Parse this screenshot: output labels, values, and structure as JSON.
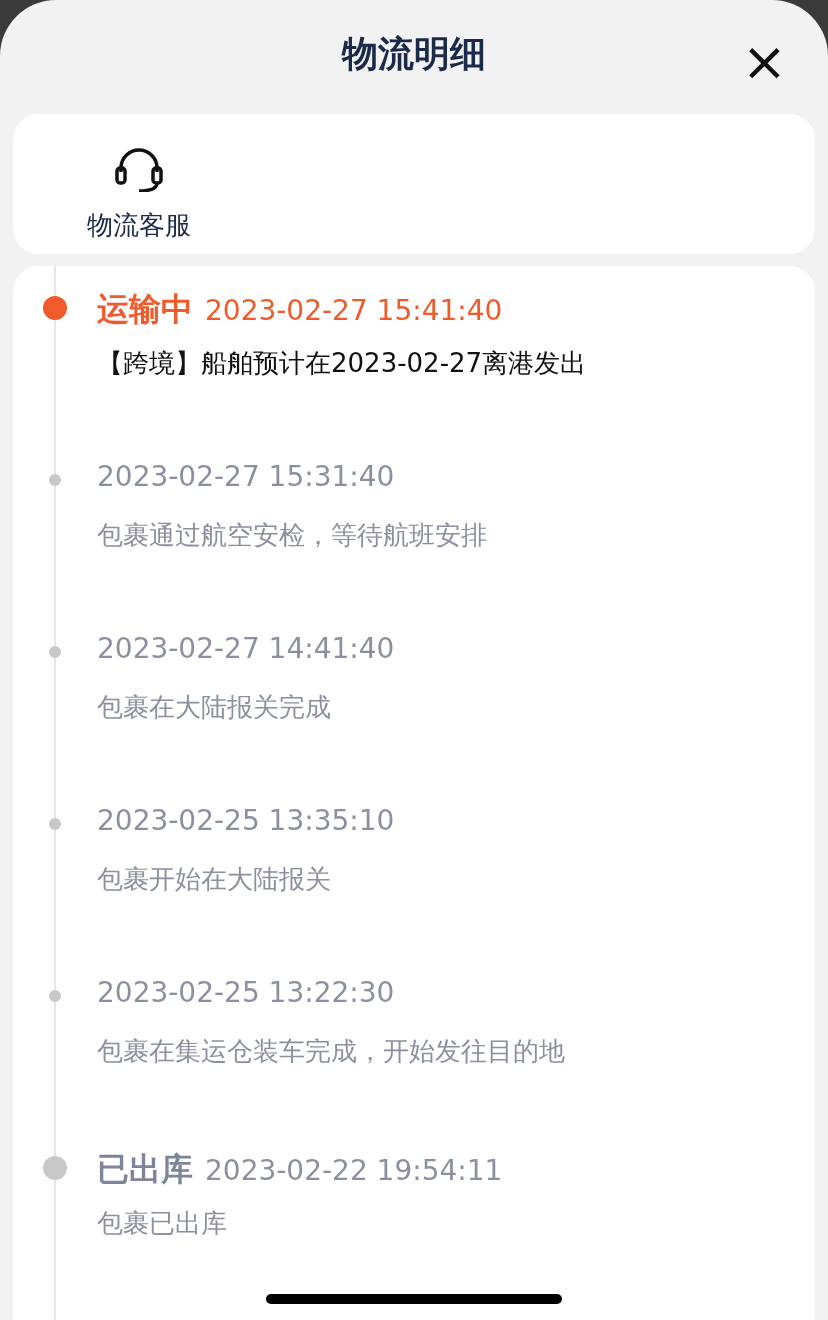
{
  "header": {
    "title": "物流明细",
    "close": "×"
  },
  "service": {
    "label": "物流客服"
  },
  "events": [
    {
      "kind": "major",
      "current": true,
      "status": "运输中",
      "time": "2023-02-27 15:41:40",
      "description": "【跨境】船舶预计在2023-02-27离港发出"
    },
    {
      "kind": "minor",
      "current": false,
      "time": "2023-02-27 15:31:40",
      "description": "包裹通过航空安检，等待航班安排"
    },
    {
      "kind": "minor",
      "current": false,
      "time": "2023-02-27 14:41:40",
      "description": "包裹在大陆报关完成"
    },
    {
      "kind": "minor",
      "current": false,
      "time": "2023-02-25 13:35:10",
      "description": "包裹开始在大陆报关"
    },
    {
      "kind": "minor",
      "current": false,
      "time": "2023-02-25 13:22:30",
      "description": "包裹在集运仓装车完成，开始发往目的地"
    },
    {
      "kind": "major",
      "current": false,
      "status": "已出库",
      "time": "2023-02-22 19:54:11",
      "description": "包裹已出库"
    }
  ]
}
